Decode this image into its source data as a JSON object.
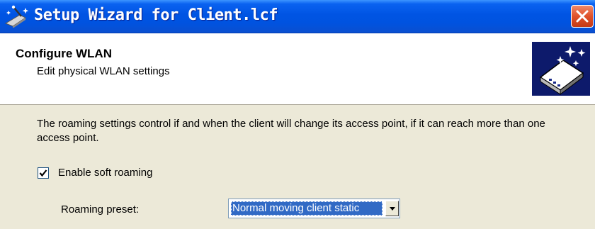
{
  "window": {
    "title": "Setup Wizard for Client.lcf",
    "title_icon": "wizard-wand-icon",
    "close_icon": "close-icon"
  },
  "header": {
    "title": "Configure WLAN",
    "subtitle": "Edit physical WLAN settings",
    "graphic_icon": "wizard-device-sparkle-icon"
  },
  "content": {
    "description": "The roaming settings control if and when the client will change its access point, if it can reach more than one access point.",
    "soft_roaming": {
      "label": "Enable soft roaming",
      "checked": true
    },
    "roaming_preset": {
      "label": "Roaming preset:",
      "value": "Normal moving client static"
    }
  },
  "colors": {
    "titlebar": "#0054e3",
    "close_button": "#e0512a",
    "dialog_background": "#ece9d8",
    "selection": "#316ac5",
    "header_graphic_background": "#0d1a6b"
  }
}
